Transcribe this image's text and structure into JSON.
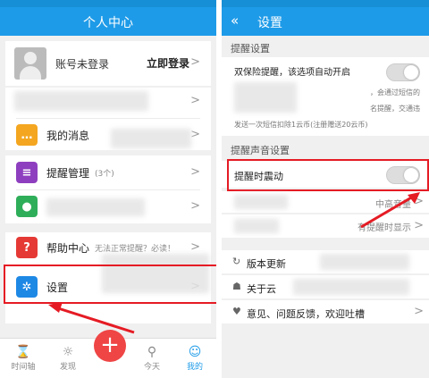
{
  "left": {
    "title": "个人中心",
    "account": {
      "label": "账号未登录",
      "action": "立即登录"
    },
    "menu": {
      "messages": "我的消息",
      "reminders": "提醒管理",
      "reminders_count": "(3个)",
      "help": "帮助中心",
      "help_sub": "无法正常提醒？必读！",
      "settings": "设置"
    },
    "nav": {
      "timeline": "时间轴",
      "discover": "发现",
      "today": "今天",
      "mine": "我的",
      "add": "+"
    }
  },
  "right": {
    "title": "设置",
    "back": "«",
    "section_reminder": "提醒设置",
    "dual_mode": "双保险提醒，该选项自动开启",
    "sms_note": "，会通过短信的",
    "sms_note2": "名提醒，交通违",
    "sms_cost": "发送一次短信扣除1云币(注册赠送20云币)",
    "section_sound": "提醒声音设置",
    "vibrate": "提醒时震动",
    "vibrate_value": "中高音量",
    "display_value": "有提醒时显示",
    "update": "版本更新",
    "about": "关于云",
    "feedback": "意见、问题反馈，欢迎吐槽"
  },
  "colors": {
    "header": "#1e9be8",
    "highlight": "#e51b24",
    "accent": "#ef4545"
  }
}
